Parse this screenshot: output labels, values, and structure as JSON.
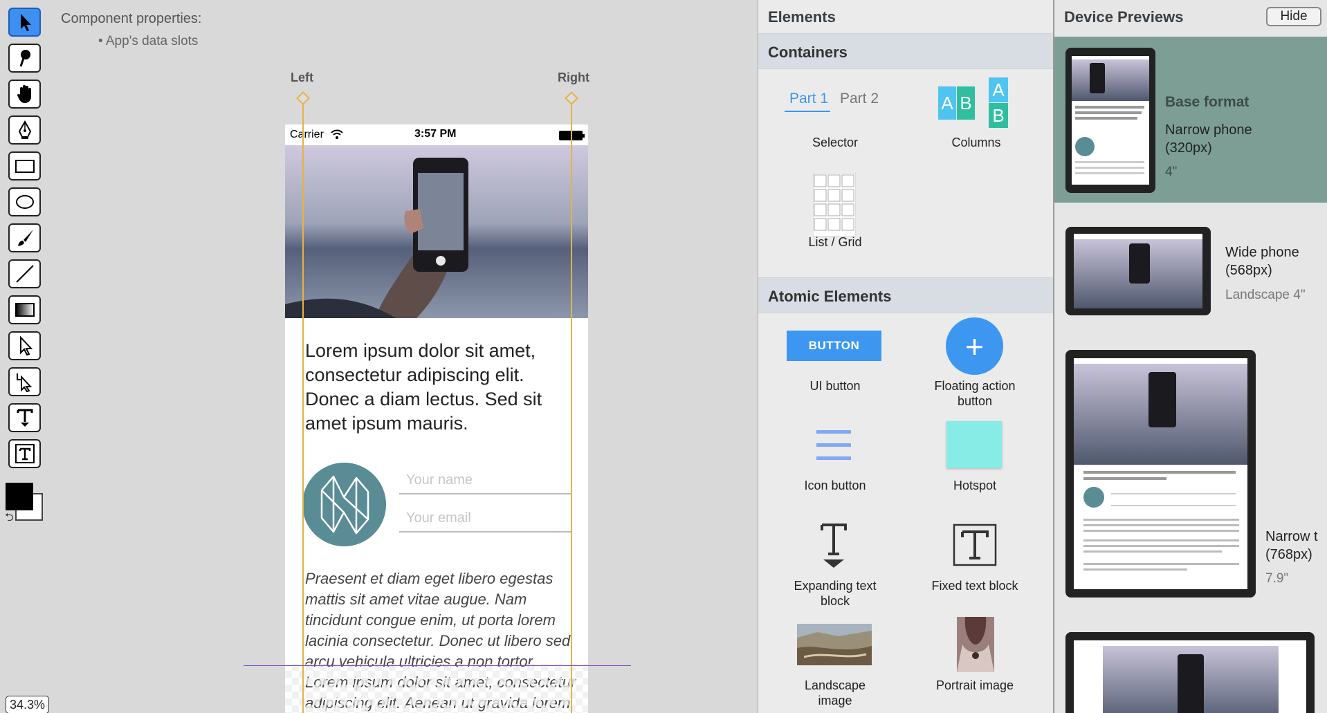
{
  "component": {
    "title": "Component properties:",
    "slot_item": "• App's data slots"
  },
  "guides": {
    "left_label": "Left",
    "right_label": "Right"
  },
  "toolbar": {
    "tools": [
      "pointer-tool",
      "lasso-tool",
      "hand-tool",
      "pen-tool",
      "rectangle-tool",
      "ellipse-tool",
      "brush-tool",
      "line-tool",
      "gradient-tool",
      "direct-select-tool",
      "group-select-tool",
      "expanding-text-tool",
      "fixed-text-tool"
    ],
    "active_tool": "pointer-tool",
    "fg_color": "#000000",
    "bg_color": "#ffffff",
    "zoom": "34.3%"
  },
  "phone": {
    "status": {
      "carrier": "Carrier",
      "time": "3:57 PM"
    },
    "headline": "Lorem ipsum dolor sit amet, consectetur adipiscing elit. Donec a diam lectus. Sed sit amet ipsum mauris.",
    "name_placeholder": "Your name",
    "email_placeholder": "Your email",
    "body": "Praesent et diam eget libero egestas mattis sit amet vitae augue. Nam tincidunt congue enim, ut porta lorem lacinia consectetur. Donec ut libero sed arcu vehicula ultricies a non tortor. Lorem ipsum dolor sit amet, consectetur adipiscing elit. Aenean ut gravida lorem."
  },
  "elements_panel": {
    "title": "Elements",
    "containers_title": "Containers",
    "selector_tabs": [
      "Part 1",
      "Part 2"
    ],
    "columns_letters": [
      "A",
      "B",
      "A",
      "B"
    ],
    "containers": [
      "Selector",
      "Columns",
      "List / Grid"
    ],
    "atomic_title": "Atomic Elements",
    "button_text": "BUTTON",
    "fab_symbol": "+",
    "atomic": {
      "ui_button": "UI button",
      "fab_line1": "Floating action",
      "fab_line2": "button",
      "icon_button": "Icon button",
      "hotspot": "Hotspot",
      "expanding_line1": "Expanding text",
      "expanding_line2": "block",
      "fixed_text": "Fixed text block",
      "landscape_line1": "Landscape",
      "landscape_line2": "image",
      "portrait": "Portrait image"
    }
  },
  "devices_panel": {
    "title": "Device Previews",
    "hide_label": "Hide",
    "devices": [
      {
        "title": "Base format",
        "name_line1": "Narrow phone",
        "name_line2": "(320px)",
        "size": "4\""
      },
      {
        "name_line1": "Wide phone",
        "name_line2": "(568px)",
        "size": "Landscape 4\""
      },
      {
        "name_line1": "Narrow t",
        "name_line2": "(768px)",
        "size": "7.9\""
      }
    ]
  },
  "colors": {
    "accent_blue": "#3d97f0",
    "guide_yellow": "#e5b345",
    "base_band": "#7d9e95",
    "avatar_teal": "#5a8c96",
    "hotspot": "#87ece6"
  }
}
